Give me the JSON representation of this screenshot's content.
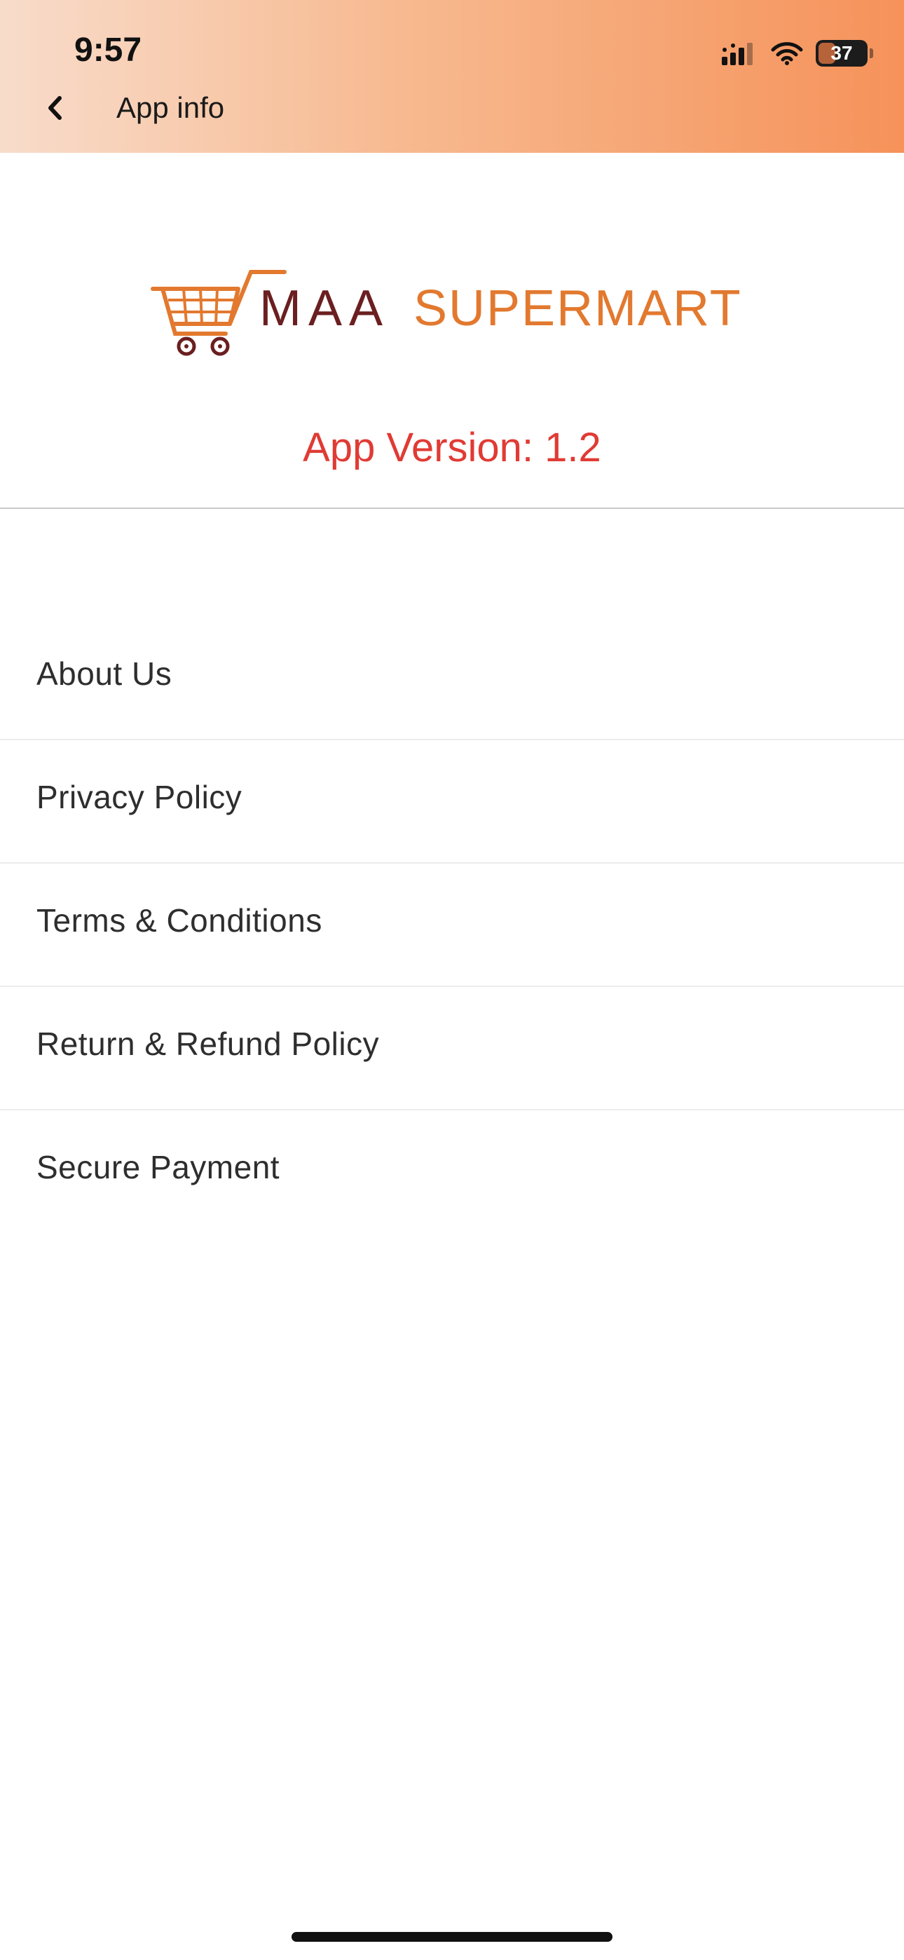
{
  "status_bar": {
    "time": "9:57",
    "battery": "37",
    "battery_level": 0.37,
    "icons": [
      "signal-icon",
      "wifi-icon",
      "battery-icon"
    ]
  },
  "header": {
    "title": "App info",
    "back_icon": "chevron-left-icon"
  },
  "logo": {
    "brand_first": "MAA",
    "brand_second": "SUPERMART",
    "icon": "shopping-cart-icon"
  },
  "app_version": "App Version: 1.2",
  "menu": {
    "items": [
      {
        "label": "About Us"
      },
      {
        "label": "Privacy Policy"
      },
      {
        "label": "Terms & Conditions"
      },
      {
        "label": "Return & Refund Policy"
      },
      {
        "label": "Secure Payment"
      }
    ]
  },
  "colors": {
    "header_gradient_start": "#f8dccb",
    "header_gradient_end": "#f6925a",
    "brand_orange": "#e2792f",
    "brand_maroon": "#6b1f20",
    "version_red": "#e03b34"
  }
}
